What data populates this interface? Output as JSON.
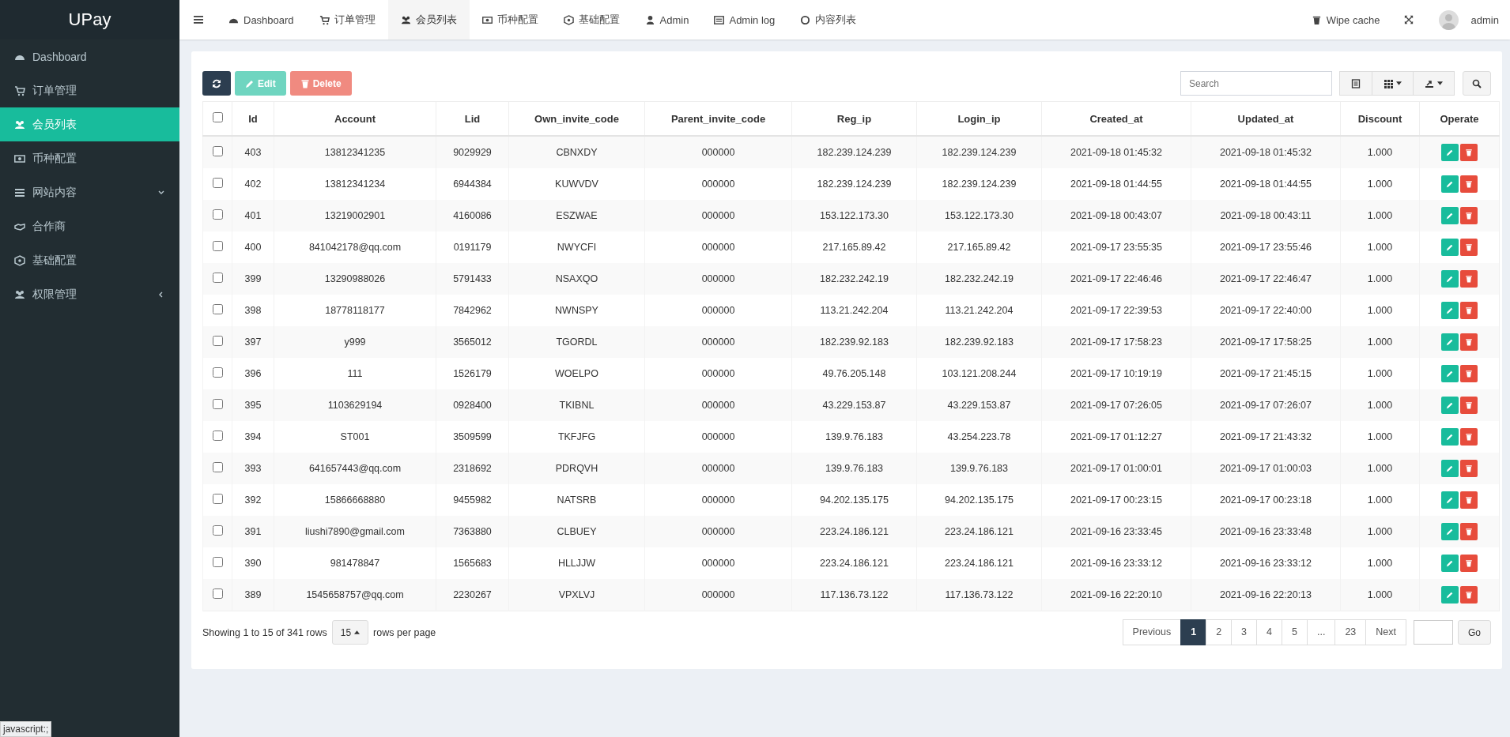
{
  "sidebar": {
    "brand": "UPay",
    "items": [
      {
        "label": "Dashboard",
        "selected": false
      },
      {
        "label": "订单管理",
        "selected": false
      },
      {
        "label": "会员列表",
        "selected": true
      },
      {
        "label": "币种配置",
        "selected": false
      },
      {
        "label": "网站内容",
        "selected": false,
        "kind": "down"
      },
      {
        "label": "合作商",
        "selected": false
      },
      {
        "label": "基础配置",
        "selected": false
      },
      {
        "label": "权限管理",
        "selected": false,
        "kind": "left"
      }
    ]
  },
  "top_nav": {
    "tabs": [
      {
        "label": "Dashboard",
        "selected": false
      },
      {
        "label": "订单管理",
        "selected": false
      },
      {
        "label": "会员列表",
        "selected": true
      },
      {
        "label": "币种配置",
        "selected": false
      },
      {
        "label": "基础配置",
        "selected": false
      },
      {
        "label": "Admin",
        "selected": false
      },
      {
        "label": "Admin log",
        "selected": false
      },
      {
        "label": "内容列表",
        "selected": false
      }
    ],
    "wipe_cache": "Wipe cache",
    "user": "admin"
  },
  "toolbar": {
    "edit": "Edit",
    "delete": "Delete",
    "search": {
      "placeholder": "Search"
    }
  },
  "table": {
    "columns": [
      "Id",
      "Account",
      "Lid",
      "Own_invite_code",
      "Parent_invite_code",
      "Reg_ip",
      "Login_ip",
      "Created_at",
      "Updated_at",
      "Discount",
      "Operate"
    ],
    "header_checked": false,
    "rows": [
      {
        "checked": false,
        "cells": [
          "403",
          "13812341235",
          "9029929",
          "CBNXDY",
          "000000",
          "182.239.124.239",
          "182.239.124.239",
          "2021-09-18 01:45:32",
          "2021-09-18 01:45:32",
          "1.000"
        ]
      },
      {
        "checked": false,
        "cells": [
          "402",
          "13812341234",
          "6944384",
          "KUWVDV",
          "000000",
          "182.239.124.239",
          "182.239.124.239",
          "2021-09-18 01:44:55",
          "2021-09-18 01:44:55",
          "1.000"
        ]
      },
      {
        "checked": false,
        "cells": [
          "401",
          "13219002901",
          "4160086",
          "ESZWAE",
          "000000",
          "153.122.173.30",
          "153.122.173.30",
          "2021-09-18 00:43:07",
          "2021-09-18 00:43:11",
          "1.000"
        ]
      },
      {
        "checked": false,
        "cells": [
          "400",
          "841042178@qq.com",
          "0191179",
          "NWYCFI",
          "000000",
          "217.165.89.42",
          "217.165.89.42",
          "2021-09-17 23:55:35",
          "2021-09-17 23:55:46",
          "1.000"
        ]
      },
      {
        "checked": false,
        "cells": [
          "399",
          "13290988026",
          "5791433",
          "NSAXQO",
          "000000",
          "182.232.242.19",
          "182.232.242.19",
          "2021-09-17 22:46:46",
          "2021-09-17 22:46:47",
          "1.000"
        ]
      },
      {
        "checked": false,
        "cells": [
          "398",
          "18778118177",
          "7842962",
          "NWNSPY",
          "000000",
          "113.21.242.204",
          "113.21.242.204",
          "2021-09-17 22:39:53",
          "2021-09-17 22:40:00",
          "1.000"
        ]
      },
      {
        "checked": false,
        "cells": [
          "397",
          "y999",
          "3565012",
          "TGORDL",
          "000000",
          "182.239.92.183",
          "182.239.92.183",
          "2021-09-17 17:58:23",
          "2021-09-17 17:58:25",
          "1.000"
        ]
      },
      {
        "checked": false,
        "cells": [
          "396",
          "111",
          "1526179",
          "WOELPO",
          "000000",
          "49.76.205.148",
          "103.121.208.244",
          "2021-09-17 10:19:19",
          "2021-09-17 21:45:15",
          "1.000"
        ]
      },
      {
        "checked": false,
        "cells": [
          "395",
          "1103629194",
          "0928400",
          "TKIBNL",
          "000000",
          "43.229.153.87",
          "43.229.153.87",
          "2021-09-17 07:26:05",
          "2021-09-17 07:26:07",
          "1.000"
        ]
      },
      {
        "checked": false,
        "cells": [
          "394",
          "ST001",
          "3509599",
          "TKFJFG",
          "000000",
          "139.9.76.183",
          "43.254.223.78",
          "2021-09-17 01:12:27",
          "2021-09-17 21:43:32",
          "1.000"
        ]
      },
      {
        "checked": false,
        "cells": [
          "393",
          "641657443@qq.com",
          "2318692",
          "PDRQVH",
          "000000",
          "139.9.76.183",
          "139.9.76.183",
          "2021-09-17 01:00:01",
          "2021-09-17 01:00:03",
          "1.000"
        ]
      },
      {
        "checked": false,
        "cells": [
          "392",
          "15866668880",
          "9455982",
          "NATSRB",
          "000000",
          "94.202.135.175",
          "94.202.135.175",
          "2021-09-17 00:23:15",
          "2021-09-17 00:23:18",
          "1.000"
        ]
      },
      {
        "checked": false,
        "cells": [
          "391",
          "liushi7890@gmail.com",
          "7363880",
          "CLBUEY",
          "000000",
          "223.24.186.121",
          "223.24.186.121",
          "2021-09-16 23:33:45",
          "2021-09-16 23:33:48",
          "1.000"
        ]
      },
      {
        "checked": false,
        "cells": [
          "390",
          "981478847",
          "1565683",
          "HLLJJW",
          "000000",
          "223.24.186.121",
          "223.24.186.121",
          "2021-09-16 23:33:12",
          "2021-09-16 23:33:12",
          "1.000"
        ]
      },
      {
        "checked": false,
        "cells": [
          "389",
          "1545658757@qq.com",
          "2230267",
          "VPXLVJ",
          "000000",
          "117.136.73.122",
          "117.136.73.122",
          "2021-09-16 22:20:10",
          "2021-09-16 22:20:13",
          "1.000"
        ]
      }
    ]
  },
  "footer": {
    "showing": "Showing 1 to 15 of 341 rows",
    "page_size": "15",
    "per_page": "rows per page",
    "pagination": [
      {
        "label": "Previous",
        "selected": false
      },
      {
        "label": "1",
        "selected": true
      },
      {
        "label": "2",
        "selected": false
      },
      {
        "label": "3",
        "selected": false
      },
      {
        "label": "4",
        "selected": false
      },
      {
        "label": "5",
        "selected": false
      },
      {
        "label": "...",
        "selected": false
      },
      {
        "label": "23",
        "selected": false
      },
      {
        "label": "Next",
        "selected": false
      }
    ],
    "go": "Go"
  },
  "status_tooltip": "javascript:;"
}
